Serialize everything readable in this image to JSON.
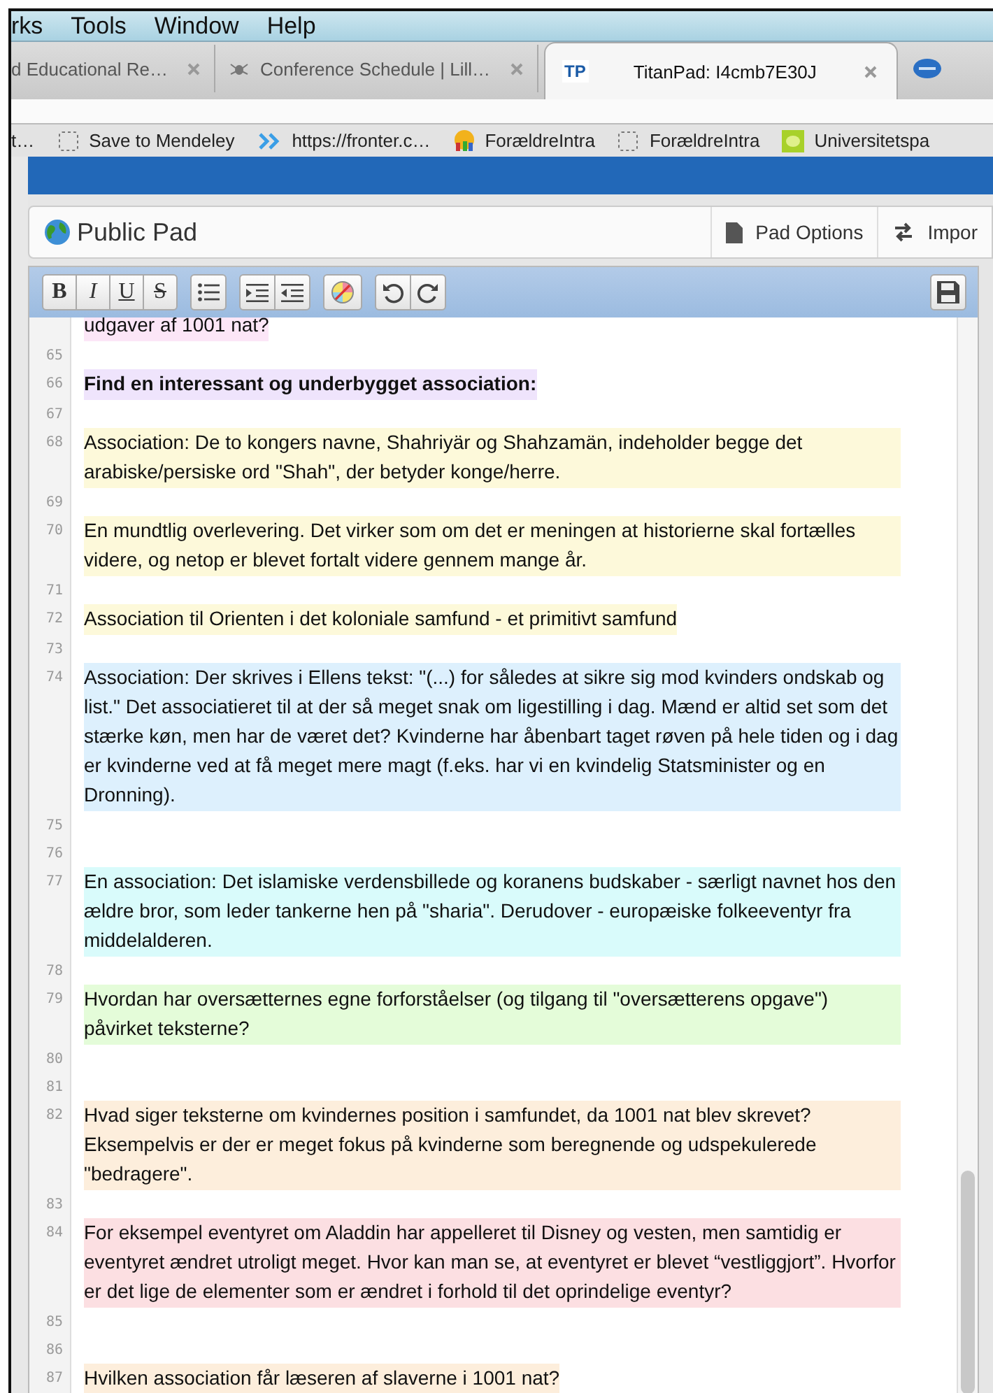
{
  "menu_bar": [
    "rks",
    "Tools",
    "Window",
    "Help"
  ],
  "tabs": [
    {
      "title": "d Educational Re…",
      "selected": false
    },
    {
      "title": "Conference Schedule | Lill…",
      "selected": false
    },
    {
      "title": "TitanPad: I4cmb7E30J",
      "badge": "TP",
      "selected": true
    }
  ],
  "bookmarks": [
    "t…",
    "Save to Mendeley",
    "https://fronter.c…",
    "ForældreIntra",
    "ForældreIntra",
    "Universitetspa"
  ],
  "pad_header": {
    "title": "Public Pad",
    "buttons": [
      "Pad Options",
      "Impor"
    ]
  },
  "format_buttons": [
    "B",
    "I",
    "U",
    "S"
  ],
  "lines": [
    {
      "text": "udgaver af 1001 nat?",
      "color": "#fce6f7"
    },
    {
      "number": "65"
    },
    {
      "number": "66",
      "text": "Find en interessant og underbygget association:",
      "color": "#efe4fc",
      "bold": true
    },
    {
      "number": "67"
    },
    {
      "number": "68",
      "text": "Association: De to kongers navne, Shahriyär og Shahzamän, indeholder begge det arabiske/persiske ord \"Shah\", der betyder konge/herre.",
      "color": "#fdf9da"
    },
    {
      "number": "69"
    },
    {
      "number": "70",
      "text": "En mundtlig overlevering. Det virker som om det er meningen at historierne skal fortælles videre, og netop er blevet fortalt videre gennem mange år.",
      "color": "#fdf9da"
    },
    {
      "number": "71"
    },
    {
      "number": "72",
      "text": "Association til Orienten i det koloniale samfund - et primitivt samfund",
      "color": "#fdf9da"
    },
    {
      "number": "73"
    },
    {
      "number": "74",
      "text": "Association: Der skrives i Ellens tekst: \"(...) for således at sikre sig mod kvinders ondskab og list.\" Det associatieret til at der så meget snak om ligestilling i dag. Mænd er altid set som det stærke køn, men har de været det? Kvinderne har åbenbart taget røven på hele tiden og i dag er kvinderne ved at få meget mere magt (f.eks. har vi en kvindelig Statsminister og en Dronning).",
      "color": "#ddf0fd"
    },
    {
      "number": "75"
    },
    {
      "number": "76"
    },
    {
      "number": "77",
      "text": "En association: Det islamiske verdensbillede og koranens budskaber - særligt navnet hos den ældre bror, som leder tankerne hen på \"sharia\". Derudover - europæiske folkeeventyr fra middelalderen.",
      "color": "#d9fbfb"
    },
    {
      "number": "78"
    },
    {
      "number": "79",
      "text": "Hvordan har oversætternes egne forforståelser (og tilgang til \"oversætterens opgave\") påvirket teksterne?",
      "color": "#e4fcd9"
    },
    {
      "number": "80"
    },
    {
      "number": "81"
    },
    {
      "number": "82",
      "text": "Hvad siger teksterne om kvindernes position i samfundet, da 1001 nat blev skrevet? Eksempelvis er der er meget fokus på kvinderne som beregnende og udspekulerede \"bedragere\".",
      "color": "#fdeedc"
    },
    {
      "number": "83"
    },
    {
      "number": "84",
      "text": "For eksempel eventyret om Aladdin har appelleret til Disney og vesten, men samtidig er eventyret ændret utroligt meget. Hvor kan man se, at eventyret er blevet “vestliggjort”. Hvorfor er det lige de elementer som er ændret i forhold til det oprindelige eventyr?",
      "color": "#fcdfe2"
    },
    {
      "number": "85"
    },
    {
      "number": "86"
    },
    {
      "number": "87",
      "text": "Hvilken association får læseren af slaverne i 1001 nat?",
      "color": "#fdeedc"
    }
  ]
}
